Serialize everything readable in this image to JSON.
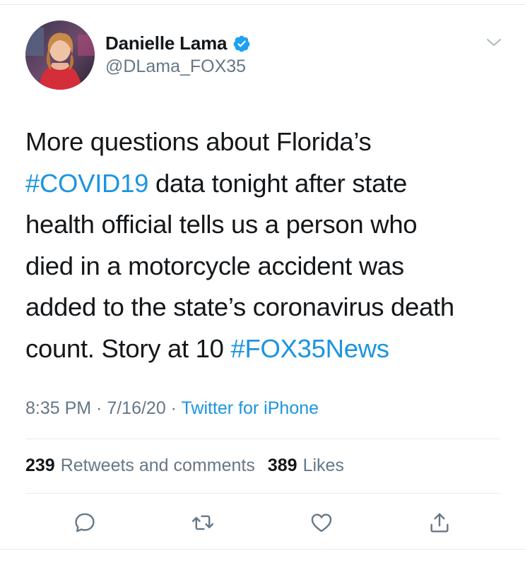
{
  "tweet": {
    "author": {
      "display_name": "Danielle Lama",
      "handle": "@DLama_FOX35",
      "verified": true
    },
    "text_lines": [
      [
        {
          "t": "More questions about Florida’s",
          "tag": false
        }
      ],
      [
        {
          "t": "#COVID19",
          "tag": true
        },
        {
          "t": " data tonight after state",
          "tag": false
        }
      ],
      [
        {
          "t": "health official tells us a person who",
          "tag": false
        }
      ],
      [
        {
          "t": "died in a motorcycle accident was",
          "tag": false
        }
      ],
      [
        {
          "t": "added to the state’s coronavirus death",
          "tag": false
        }
      ],
      [
        {
          "t": "count. Story at 10 ",
          "tag": false
        },
        {
          "t": "#FOX35News",
          "tag": true
        }
      ]
    ],
    "timestamp": "8:35 PM · 7/16/20 · ",
    "source": "Twitter for iPhone",
    "stats": {
      "retweets_count": "239",
      "retweets_label": "Retweets and comments",
      "likes_count": "389",
      "likes_label": "Likes"
    }
  },
  "icons": {
    "verified": "verified-badge-icon",
    "menu": "chevron-down-icon",
    "reply": "comment-bubble-icon",
    "retweet": "retweet-arrows-icon",
    "like": "heart-outline-icon",
    "share": "share-upload-icon"
  },
  "colors": {
    "accent": "#1b95e0",
    "secondary_text": "#657786",
    "primary_text": "#14171a",
    "divider": "#e6ecf0",
    "verified_fill": "#1da1f2"
  }
}
